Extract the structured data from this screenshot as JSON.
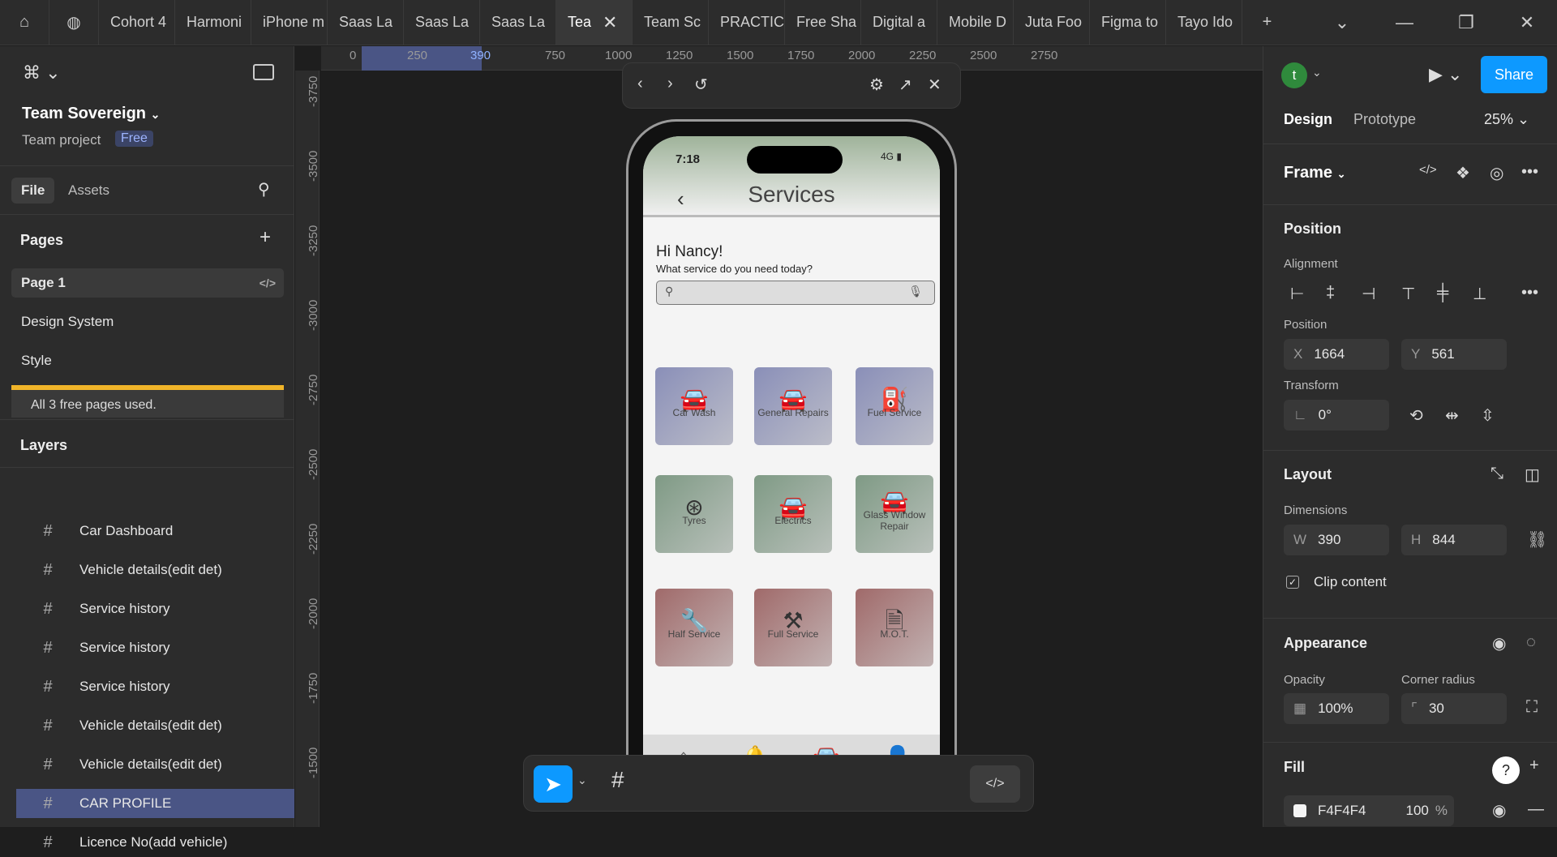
{
  "tabs": [
    "Cohort 4",
    "Harmoni",
    "iPhone m",
    "Saas La",
    "Saas La",
    "Saas La",
    "Tea",
    "Team Sc",
    "PRACTIC",
    "Free Sha",
    "Digital a",
    "Mobile D",
    "Juta Foo",
    "Figma to",
    "Tayo Ido"
  ],
  "left": {
    "team_name": "Team Sovereign",
    "team_type": "Team project",
    "plan_badge": "Free",
    "file_tab": "File",
    "assets_tab": "Assets",
    "pages_title": "Pages",
    "pages": [
      "Page 1",
      "Design System",
      "Style"
    ],
    "pages_notice": "All 3 free pages used.",
    "layers_title": "Layers",
    "layers": [
      "Car Dashboard",
      "Vehicle details(edit det)",
      "Service history",
      "Service history",
      "Service history",
      "Vehicle details(edit det)",
      "Vehicle details(edit det)",
      "CAR PROFILE",
      "Licence No(add vehicle)"
    ],
    "selected_layer_index": 7
  },
  "rulers": {
    "h": [
      "0",
      "250",
      "390",
      "750",
      "1000",
      "1250",
      "1500",
      "1750",
      "2000",
      "2250",
      "2500",
      "2750"
    ],
    "v": [
      "-3750",
      "-3500",
      "-3250",
      "-3000",
      "-2750",
      "-2500",
      "-2250",
      "-2000",
      "-1750",
      "-1500"
    ]
  },
  "phone": {
    "time": "7:18",
    "network": "4G",
    "title": "Services",
    "greeting": "Hi Nancy!",
    "prompt": "What service do you need today?",
    "services": [
      {
        "label": "Car Wash",
        "icon": "car-icon",
        "color": "#8a8fb8"
      },
      {
        "label": "General Repairs",
        "icon": "car-icon",
        "color": "#8a8fb8"
      },
      {
        "label": "Fuel Service",
        "icon": "fuel-icon",
        "color": "#8a8fb8"
      },
      {
        "label": "Tyres",
        "icon": "tyre-icon",
        "color": "#7f9a85"
      },
      {
        "label": "Electrics",
        "icon": "car-icon",
        "color": "#7f9a85"
      },
      {
        "label": "Glass Window Repair",
        "icon": "car-icon",
        "color": "#7f9a85"
      },
      {
        "label": "Half Service",
        "icon": "wrench-icon",
        "color": "#a06a6a"
      },
      {
        "label": "Full Service",
        "icon": "tools-icon",
        "color": "#a06a6a"
      },
      {
        "label": "M.O.T.",
        "icon": "mot-icon",
        "color": "#a06a6a"
      }
    ],
    "nav": [
      "Home",
      "Notifications",
      "Services",
      "My Account"
    ]
  },
  "right": {
    "user_initial": "t",
    "share": "Share",
    "design_tab": "Design",
    "prototype_tab": "Prototype",
    "zoom": "25%",
    "frame_label": "Frame",
    "position_title": "Position",
    "alignment_label": "Alignment",
    "position_label": "Position",
    "x_label": "X",
    "x": "1664",
    "y_label": "Y",
    "y": "561",
    "transform_label": "Transform",
    "rotation": "0°",
    "layout_title": "Layout",
    "dimensions_label": "Dimensions",
    "w_label": "W",
    "w": "390",
    "h_label": "H",
    "h": "844",
    "clip_label": "Clip content",
    "appearance_title": "Appearance",
    "opacity_label": "Opacity",
    "opacity": "100%",
    "radius_label": "Corner radius",
    "radius": "30",
    "fill_title": "Fill",
    "fill_hex": "F4F4F4",
    "fill_opacity": "100",
    "fill_unit": "%",
    "fill_color": "#F4F4F4"
  }
}
